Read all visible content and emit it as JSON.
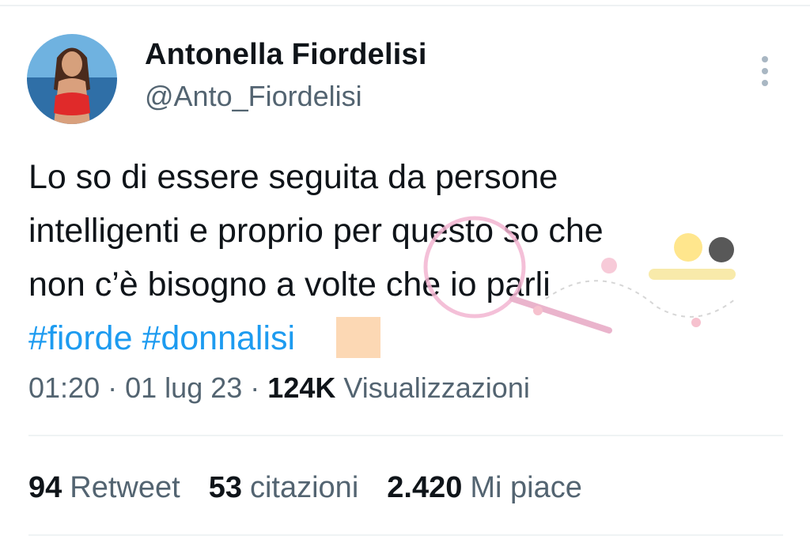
{
  "author": {
    "display_name": "Antonella Fiordelisi",
    "handle": "@Anto_Fiordelisi"
  },
  "icons": {
    "avatar": "profile-photo",
    "more": "more-vertical-icon",
    "emoji": "peach-square-emoji"
  },
  "tweet": {
    "lines": [
      "Lo so di essere seguita da persone",
      "intelligenti e proprio per questo so che",
      "non c’è bisogno a volte che io parli"
    ],
    "hashtags": [
      "#fiorde",
      "#donnalisi"
    ]
  },
  "meta": {
    "time": "01:20",
    "separator": "·",
    "date": "01 lug 23",
    "views_count": "124K",
    "views_label": "Visualizzazioni"
  },
  "stats": {
    "retweets_count": "94",
    "retweets_label": "Retweet",
    "quotes_count": "53",
    "quotes_label": "citazioni",
    "likes_count": "2.420",
    "likes_label": "Mi piace"
  },
  "colors": {
    "text": "#0f1419",
    "secondary": "#536471",
    "link": "#1d9bf0",
    "divider": "#eff3f4"
  }
}
